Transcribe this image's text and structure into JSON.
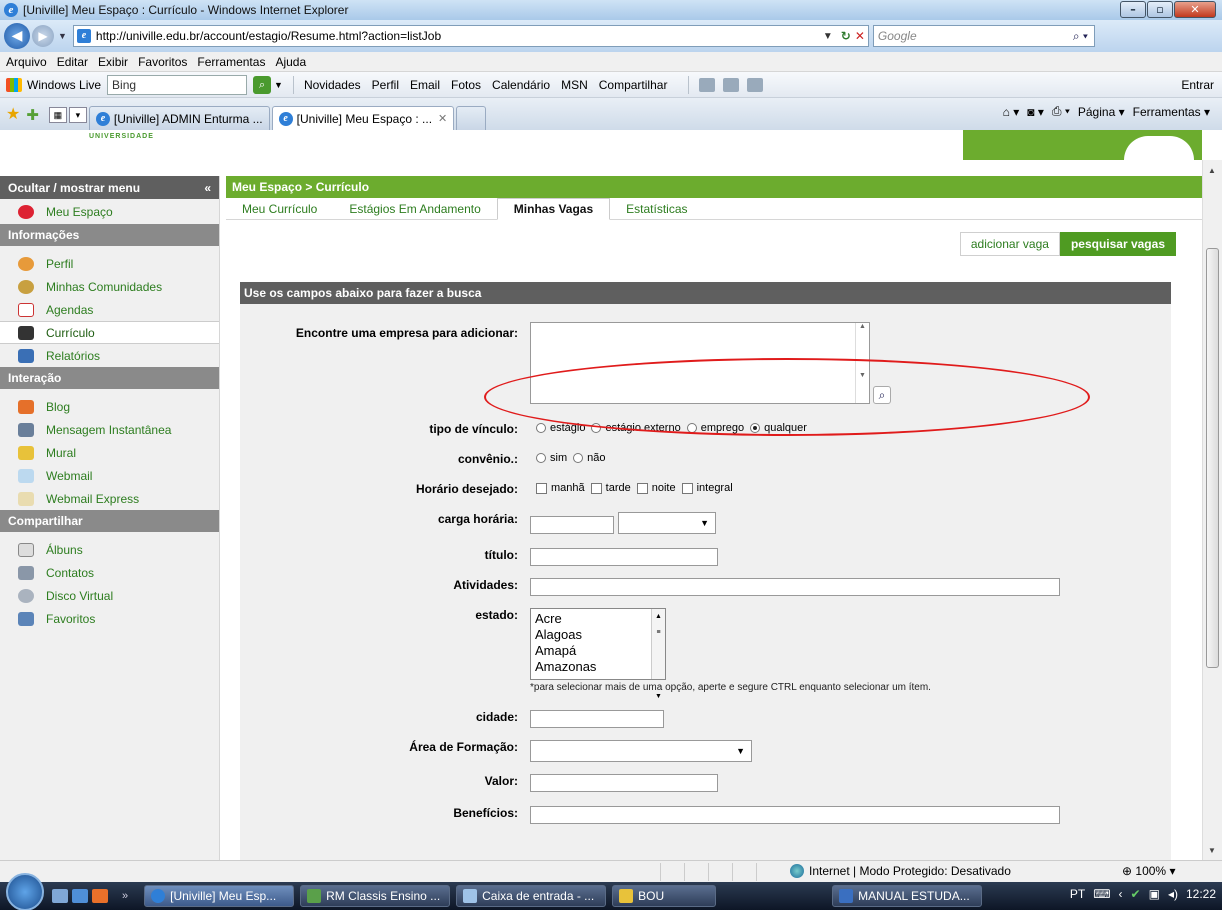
{
  "window": {
    "title": "[Univille] Meu Espaço : Currículo - Windows Internet Explorer"
  },
  "address": {
    "url": "http://univille.edu.br/account/estagio/Resume.html?action=listJob",
    "search_placeholder": "Google"
  },
  "menubar": [
    "Arquivo",
    "Editar",
    "Exibir",
    "Favoritos",
    "Ferramentas",
    "Ajuda"
  ],
  "livebar": {
    "brand": "Windows Live",
    "search_value": "Bing",
    "links": [
      "Novidades",
      "Perfil",
      "Email",
      "Fotos",
      "Calendário",
      "MSN",
      "Compartilhar"
    ],
    "signin": "Entrar"
  },
  "tabs": [
    {
      "label": "[Univille] ADMIN Enturma ...",
      "active": false
    },
    {
      "label": "[Univille] Meu Espaço : ...",
      "active": true
    }
  ],
  "tabtools": {
    "page": "Página ▾",
    "tools": "Ferramentas ▾"
  },
  "logo_text": "UNIVERSIDADE",
  "sidebar": {
    "toggle_label": "Ocultar / mostrar menu",
    "top_item": "Meu Espaço",
    "sections": [
      {
        "title": "Informações",
        "items": [
          "Perfil",
          "Minhas Comunidades",
          "Agendas",
          "Currículo",
          "Relatórios"
        ]
      },
      {
        "title": "Interação",
        "items": [
          "Blog",
          "Mensagem Instantânea",
          "Mural",
          "Webmail",
          "Webmail Express"
        ]
      },
      {
        "title": "Compartilhar",
        "items": [
          "Álbuns",
          "Contatos",
          "Disco Virtual",
          "Favoritos"
        ]
      }
    ]
  },
  "main": {
    "breadcrumb": "Meu Espaço > Currículo",
    "subtabs": [
      "Meu Currículo",
      "Estágios Em Andamento",
      "Minhas Vagas",
      "Estatísticas"
    ],
    "active_subtab": "Minhas Vagas",
    "actions": {
      "add": "adicionar vaga",
      "search": "pesquisar vagas"
    },
    "form_header": "Use os campos abaixo para fazer a busca",
    "fields": {
      "empresa": "Encontre uma empresa para adicionar:",
      "vinculo": "tipo de vínculo:",
      "vinculo_options": [
        "estágio",
        "estágio externo",
        "emprego",
        "qualquer"
      ],
      "convenio": "convênio.:",
      "convenio_options": [
        "sim",
        "não"
      ],
      "horario": "Horário desejado:",
      "horario_options": [
        "manhã",
        "tarde",
        "noite",
        "integral"
      ],
      "carga": "carga horária:",
      "titulo": "título:",
      "atividades": "Atividades:",
      "estado": "estado:",
      "estado_options": [
        "Acre",
        "Alagoas",
        "Amapá",
        "Amazonas"
      ],
      "estado_hint": "*para selecionar mais de uma opção, aperte e segure CTRL enquanto selecionar um ítem.",
      "cidade": "cidade:",
      "area": "Área de Formação:",
      "valor": "Valor:",
      "beneficios": "Benefícios:"
    }
  },
  "status": {
    "zone": "Internet | Modo Protegido: Desativado",
    "zoom": "100%"
  },
  "taskbar": {
    "items": [
      "[Univille] Meu Esp...",
      "RM Classis Ensino ...",
      "Caixa de entrada - ...",
      "BOU",
      "MANUAL ESTUDA..."
    ],
    "lang": "PT",
    "clock": "12:22"
  }
}
